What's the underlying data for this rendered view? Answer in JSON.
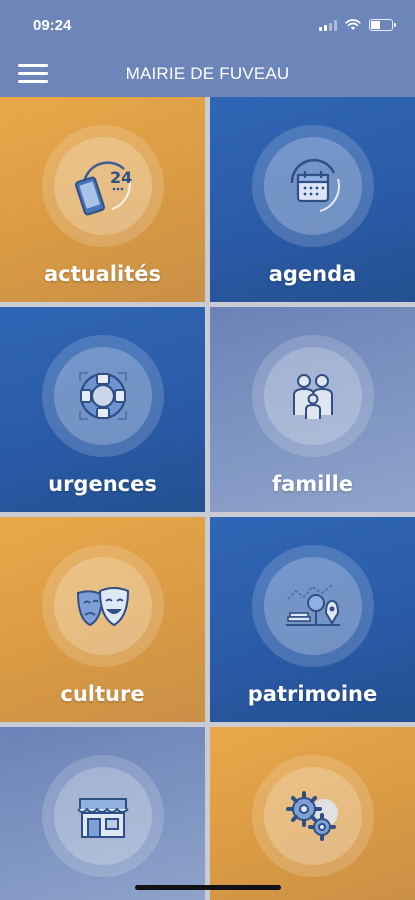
{
  "status_bar": {
    "time": "09:24",
    "battery_level": 0.45
  },
  "header": {
    "title": "MAIRIE DE FUVEAU",
    "menu_icon": "hamburger-icon"
  },
  "tiles": [
    {
      "label": "actualités",
      "icon": "news-phone-24-icon",
      "color": "gold"
    },
    {
      "label": "agenda",
      "icon": "calendar-icon",
      "color": "blue"
    },
    {
      "label": "urgences",
      "icon": "lifebuoy-icon",
      "color": "blue"
    },
    {
      "label": "famille",
      "icon": "family-icon",
      "color": "slate"
    },
    {
      "label": "culture",
      "icon": "theater-masks-icon",
      "color": "gold"
    },
    {
      "label": "patrimoine",
      "icon": "heritage-landmark-icon",
      "color": "blue"
    },
    {
      "label": "",
      "icon": "shop-storefront-icon",
      "color": "slate"
    },
    {
      "label": "",
      "icon": "settings-gears-icon",
      "color": "gold"
    }
  ],
  "tile_icon_text": {
    "actualites_number": "24"
  },
  "colors": {
    "header": "#6d86ba",
    "gold": "#e0a046",
    "blue": "#2c5fad",
    "slate": "#7c93c3"
  }
}
